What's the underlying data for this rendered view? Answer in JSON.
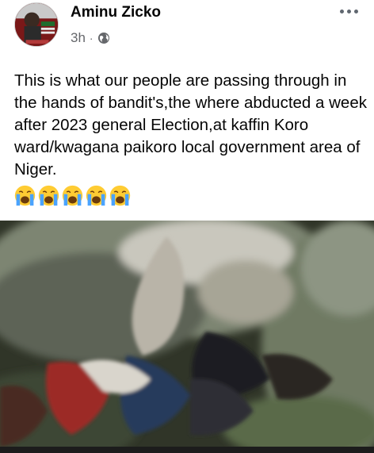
{
  "post": {
    "author": "Aminu Zicko",
    "time": "3h",
    "separator": "·",
    "audience_icon": "globe-icon",
    "text": "This is what our people are passing through in the hands of bandit's,the where abducted a week after 2023 general Election,at kaffin Koro ward/kwagana paikoro local government area of Niger.",
    "emojis": [
      "crying-face",
      "crying-face",
      "crying-face",
      "crying-face",
      "crying-face"
    ],
    "image_alt": ""
  },
  "colors": {
    "text": "#050505",
    "meta": "#65676b",
    "emoji": "#ffcc33"
  }
}
